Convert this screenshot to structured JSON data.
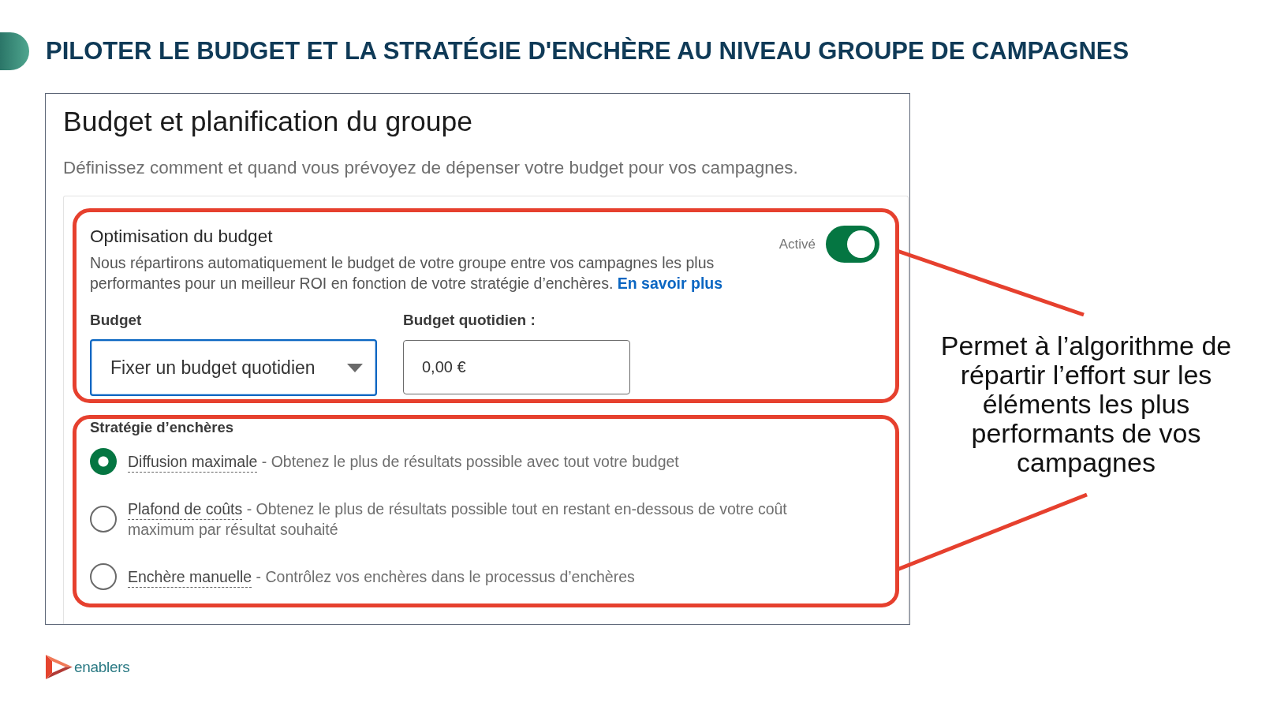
{
  "header": {
    "title": "PILOTER LE BUDGET ET LA STRATÉGIE D'ENCHÈRE AU NIVEAU GROUPE DE CAMPAGNES"
  },
  "panel": {
    "title": "Budget et planification du groupe",
    "subtitle": "Définissez comment et quand vous prévoyez de dépenser votre budget pour vos campagnes.",
    "optimisation": {
      "title": "Optimisation du budget",
      "description": "Nous répartirons automatiquement le budget de votre groupe entre vos campagnes les plus performantes pour un meilleur ROI en fonction de votre stratégie d’enchères.",
      "link": "En savoir plus",
      "toggle": {
        "label": "Activé",
        "on": true
      }
    },
    "budget_fields": [
      {
        "kind": "select",
        "label": "Budget",
        "value": "Fixer un budget quotidien"
      },
      {
        "kind": "input",
        "label": "Budget quotidien :",
        "value": "0,00 €"
      }
    ],
    "strategy": {
      "title": "Stratégie d’enchères",
      "options": [
        {
          "name": "Diffusion maximale",
          "description": "- Obtenez le plus de résultats possible avec tout votre budget",
          "selected": true
        },
        {
          "name": "Plafond de coûts",
          "description": "- Obtenez le plus de résultats possible tout en restant en-dessous de votre coût maximum par résultat souhaité",
          "selected": false
        },
        {
          "name": "Enchère manuelle",
          "description": "- Contrôlez vos enchères dans le processus d’enchères",
          "selected": false
        }
      ]
    }
  },
  "annotation": {
    "text": "Permet à l’algorithme de répartir l’effort sur les éléments les plus performants de vos campagnes"
  },
  "logo": {
    "text": "enablers"
  }
}
